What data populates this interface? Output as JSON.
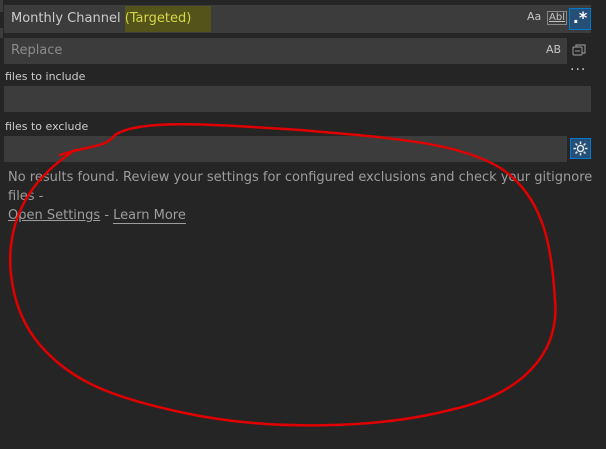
{
  "search": {
    "value_plain": "Monthly Channel ",
    "value_highlight": "(Targeted)",
    "match_case_label": "Aa",
    "match_word_label": "Abl",
    "regex_label": ".*"
  },
  "replace": {
    "placeholder": "Replace",
    "preserve_case_label": "AB"
  },
  "more_label": "···",
  "include": {
    "label": "files to include",
    "value": ""
  },
  "exclude": {
    "label": "files to exclude",
    "value": ""
  },
  "message": {
    "text": "No results found. Review your settings for configured exclusions and check your gitignore files - ",
    "separator": " - ",
    "open_settings": "Open Settings",
    "learn_more": "Learn More"
  },
  "colors": {
    "annotation": "#e00000",
    "highlight": "#53531a",
    "toggle_active": "#264f78"
  }
}
